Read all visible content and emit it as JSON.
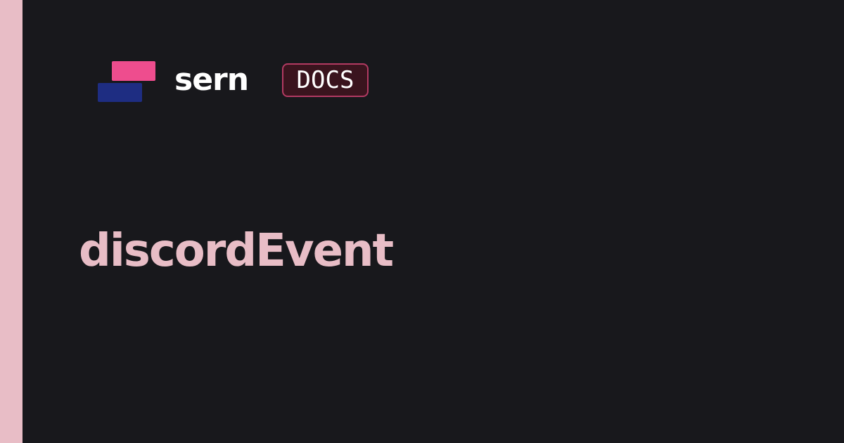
{
  "brand": {
    "name": "sern",
    "badge": "DOCS",
    "logo_icon": "stacked-bars-logo-icon"
  },
  "page": {
    "title": "discordEvent"
  },
  "colors": {
    "background": "#18181c",
    "accent_strip": "#e8bdc6",
    "logo_top": "#ee4d8e",
    "logo_bottom": "#1e2d82",
    "badge_border": "#b23a62",
    "badge_background": "#3a141e",
    "brand_text": "#ffffff",
    "title_text": "#e8bdc6"
  }
}
